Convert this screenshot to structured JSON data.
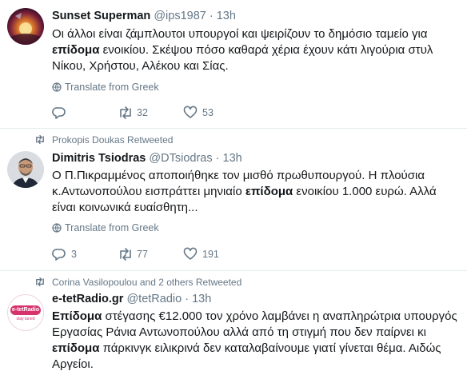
{
  "tweets": [
    {
      "name": "Sunset Superman",
      "handle": "@ips1987",
      "dot": "·",
      "time": "13h",
      "body": [
        {
          "t": "Οι άλλοι είναι ζάμπλουτοι υπουργοί και ψειρίζουν το δημόσιο ταμείο για "
        },
        {
          "b": "επίδομα"
        },
        {
          "t": " ενοικίου. Σκέψου πόσο καθαρά χέρια έχουν κάτι λιγούρια στυλ Νίκου, Χρήστου, Αλέκου και Σίας."
        }
      ],
      "translate": "Translate from Greek",
      "replies": "",
      "retweets": "32",
      "likes": "53"
    },
    {
      "context": "Prokopis Doukas Retweeted",
      "name": "Dimitris Tsiodras",
      "handle": "@DTsiodras",
      "dot": "·",
      "time": "13h",
      "body": [
        {
          "t": "Ο Π.Πικραμμένος αποποιήθηκε τον μισθό πρωθυπουργού. Η  πλούσια κ.Αντωνοπούλου εισπράττει μηνιαίο "
        },
        {
          "b": "επίδομα"
        },
        {
          "t": " ενοικίου 1.000 ευρώ. Αλλά είναι κοινωνικά ευαίσθητη..."
        }
      ],
      "translate": "Translate from Greek",
      "replies": "3",
      "retweets": "77",
      "likes": "191"
    },
    {
      "context": "Corina Vasilopoulou and 2 others Retweeted",
      "name": "e-tetRadio.gr",
      "handle": "@tetRadio",
      "dot": "·",
      "time": "13h",
      "avatar_text": "e-tetRadio",
      "avatar_subtext": "stay tuned",
      "body": [
        {
          "b": "Επίδομα"
        },
        {
          "t": " στέγασης €12.000 τον χρόνο λαμβάνει η αναπληρώτρια υπουργός Εργασίας Ράνια Αντωνοπούλου αλλά από τη στιγμή που δεν παίρνει κι "
        },
        {
          "b": "επίδομα"
        },
        {
          "t": " πάρκινγκ ειλικρινά δεν καταλαβαίνουμε γιατί γίνεται θέμα. Αιδώς Αργείοι."
        }
      ]
    }
  ],
  "icons": {
    "reply": "reply-icon",
    "retweet": "retweet-icon",
    "like": "heart-icon",
    "translate": "globe-icon",
    "retweeted_context": "retweet-context-icon"
  },
  "colors": {
    "secondary_text": "#657786",
    "primary_text": "#14171a",
    "separator": "#e6ecf0",
    "radio_logo": "#d6336c"
  }
}
